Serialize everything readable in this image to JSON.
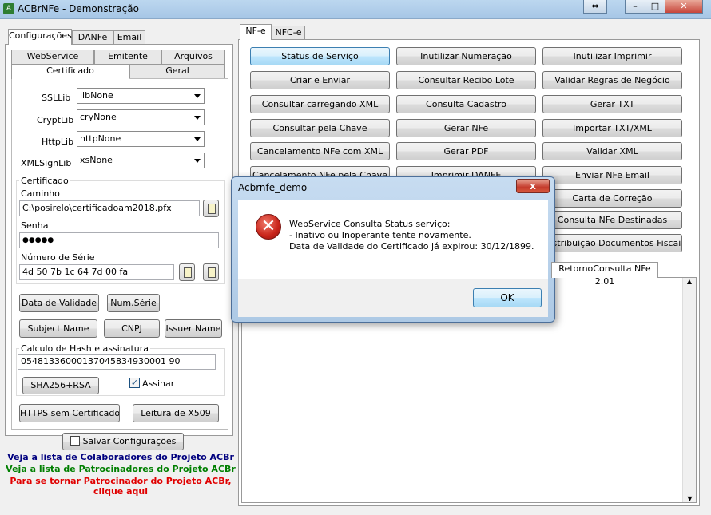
{
  "window": {
    "title": "ACBrNFe - Demonstração"
  },
  "left": {
    "main_tabs": [
      "Configurações",
      "DANFe",
      "Email"
    ],
    "sub_tabs_row1": [
      "WebService",
      "Emitente",
      "Arquivos"
    ],
    "sub_tabs_row2": [
      "Certificado",
      "Geral"
    ],
    "ssllib": {
      "label": "SSLLib",
      "value": "libNone"
    },
    "cryptlib": {
      "label": "CryptLib",
      "value": "cryNone"
    },
    "httplib": {
      "label": "HttpLib",
      "value": "httpNone"
    },
    "xmlsignlib": {
      "label": "XMLSignLib",
      "value": "xsNone"
    },
    "certificado_group": "Certificado",
    "caminho_label": "Caminho",
    "caminho_value": "C:\\posirelo\\certificadoam2018.pfx",
    "senha_label": "Senha",
    "senha_value": "●●●●●",
    "numserie_label": "Número de Série",
    "numserie_value": "4d 50 7b 1c 64 7d 00 fa",
    "btn_data_validade": "Data de Validade",
    "btn_num_serie": "Num.Série",
    "btn_subject_name": "Subject Name",
    "btn_cnpj": "CNPJ",
    "btn_issuer_name": "Issuer Name",
    "hash_group": "Calculo de Hash e assinatura",
    "hash_value": "05481336000137045834930001 90",
    "btn_sha": "SHA256+RSA",
    "assinar_label": "Assinar",
    "assinar_checked": true,
    "btn_https": "HTTPS sem Certificado",
    "btn_leitura": "Leitura de X509",
    "btn_salvar": "Salvar Configurações",
    "link_colaboradores": "Veja a lista de Colaboradores do Projeto ACBr",
    "link_patrocinadores": "Veja a lista de Patrocinadores do Projeto ACBr",
    "link_tornar_1": "Para se tornar Patrocinador do Projeto ACBr,",
    "link_tornar_2": "clique aqui",
    "colors": {
      "link_blue": "#00007f",
      "link_green": "#007f00",
      "link_red": "#e00000"
    }
  },
  "right": {
    "tabs": [
      "NF-e",
      "NFC-e"
    ],
    "col1": [
      "Status de Serviço",
      "Criar e Enviar",
      "Consultar carregando XML",
      "Consultar pela Chave",
      "Cancelamento NFe com XML",
      "Cancelamento NFe pela Chave"
    ],
    "col2": [
      "Inutilizar Numeração",
      "Consultar Recibo Lote",
      "Consulta Cadastro",
      "Gerar NFe",
      "Gerar PDF",
      "Imprimir DANFE"
    ],
    "col3": [
      "Inutilizar Imprimir",
      "Validar Regras de Negócio",
      "Gerar TXT",
      "Importar TXT/XML",
      "Validar XML",
      "Enviar NFe Email",
      "Carta de Correção",
      "Consulta NFe Destinadas",
      "Distribuição Documentos Fiscais"
    ],
    "result_tab": "RetornoConsulta NFe 2.01"
  },
  "dialog": {
    "title": "Acbrnfe_demo",
    "close_label": "x",
    "line1": "WebService Consulta Status serviço:",
    "line2": "- Inativo ou Inoperante tente novamente.",
    "line3": "Data de Validade do Certificado já expirou: 30/12/1899.",
    "ok_label": "OK"
  }
}
